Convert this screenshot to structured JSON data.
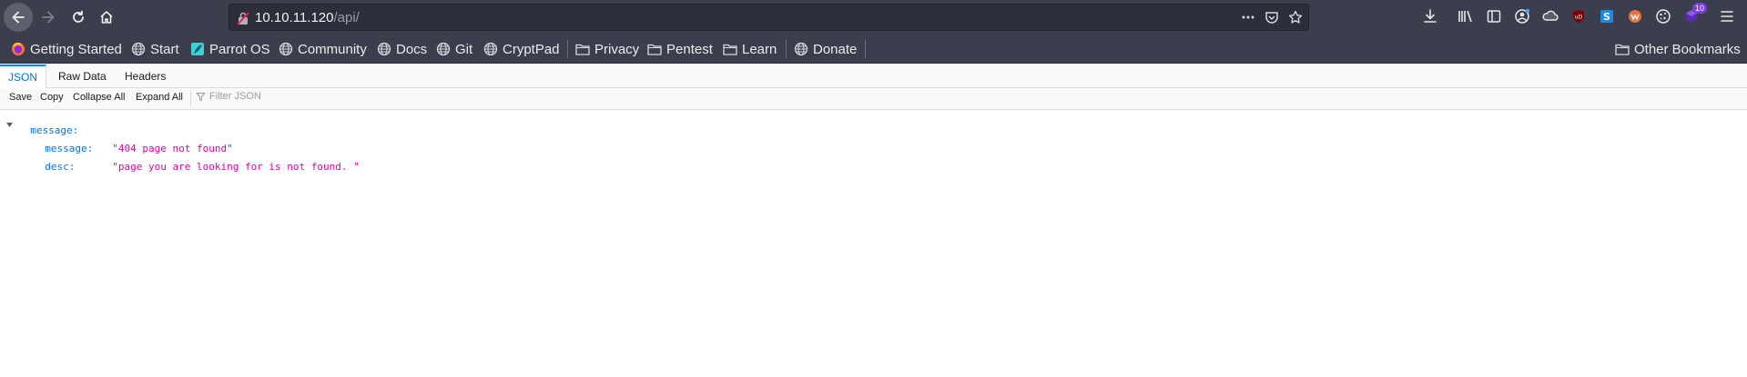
{
  "browser": {
    "url_host": "10.10.11.120",
    "url_path": "/api/",
    "ext_badge": "10"
  },
  "bookmarks": [
    "Getting Started",
    "Start",
    "Parrot OS",
    "Community",
    "Docs",
    "Git",
    "CryptPad",
    "Privacy",
    "Pentest",
    "Learn",
    "Donate"
  ],
  "other_bookmarks": "Other Bookmarks",
  "json_viewer": {
    "tabs": [
      "JSON",
      "Raw Data",
      "Headers"
    ],
    "toolbar": {
      "save": "Save",
      "copy": "Copy",
      "collapse_all": "Collapse All",
      "expand_all": "Expand All",
      "filter_placeholder": "Filter JSON"
    },
    "root_key": "message:",
    "rows": [
      {
        "key": "message:",
        "value": "\"404 page not found\""
      },
      {
        "key": "desc:",
        "value": "\"page you are looking for is not found. \""
      }
    ]
  }
}
